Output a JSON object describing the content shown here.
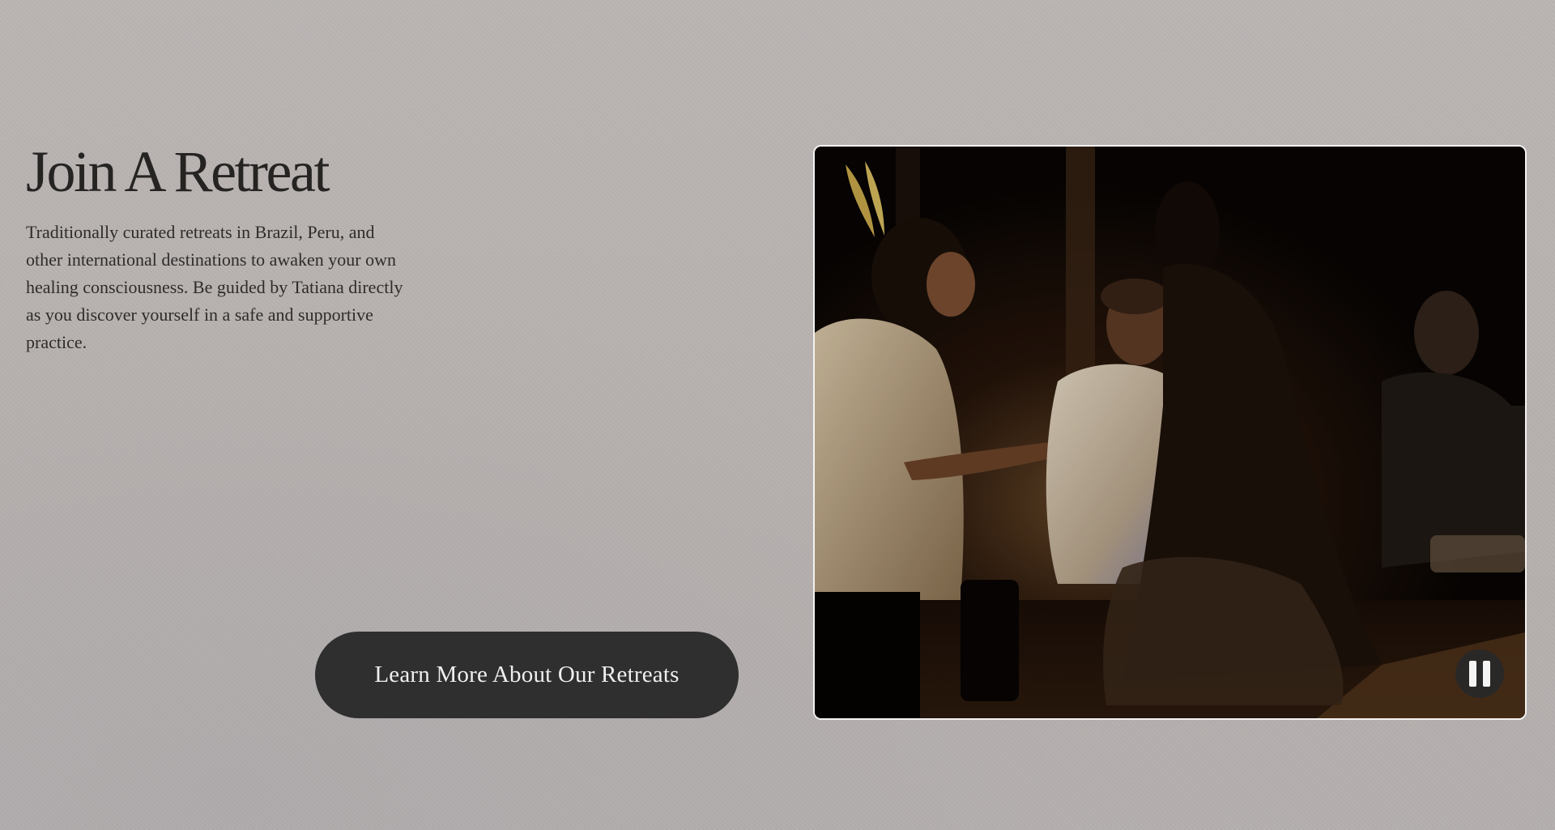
{
  "retreat": {
    "heading": "Join A Retreat",
    "description": "Traditionally curated retreats in Brazil, Peru, and other international destinations to awaken your own healing consciousness. Be guided by Tatiana directly as you discover yourself in a safe and supportive practice.",
    "cta_label": "Learn More About Our Retreats"
  },
  "video": {
    "state": "playing",
    "control_icon": "pause-icon"
  },
  "colors": {
    "background": "#b7b1af",
    "heading": "#262423",
    "button_bg": "#2f2f2f",
    "button_text": "#f1efee",
    "video_border": "#f3f1f0"
  }
}
